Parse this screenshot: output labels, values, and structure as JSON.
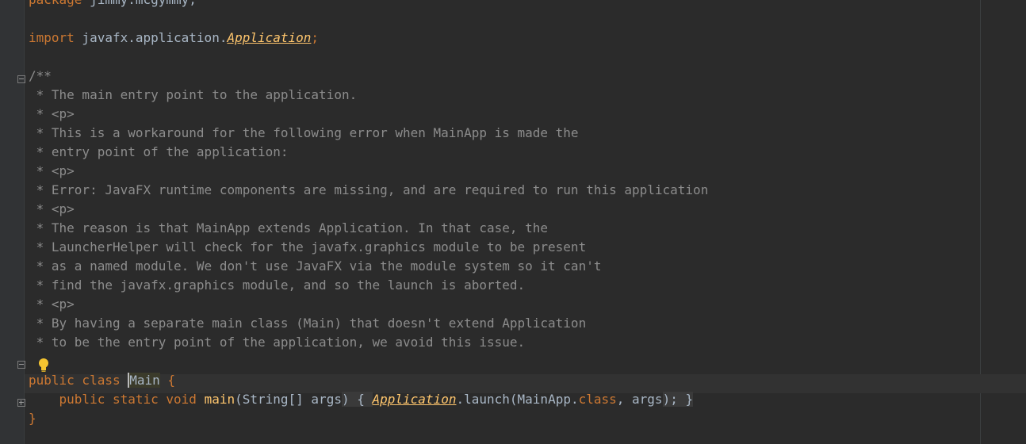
{
  "editor": {
    "lines": {
      "package_kw": "package",
      "package_name": " jimmy.mcgymmy;",
      "import_kw": "import",
      "import_path": " javafx.application.",
      "import_class": "Application",
      "import_end": ";",
      "doc_open": "/**",
      "doc_1": " * The main entry point to the application.",
      "doc_2": " * <p>",
      "doc_3": " * This is a workaround for the following error when MainApp is made the",
      "doc_4": " * entry point of the application:",
      "doc_5": " * <p>",
      "doc_6": " * Error: JavaFX runtime components are missing, and are required to run this application",
      "doc_7": " * <p>",
      "doc_8": " * The reason is that MainApp extends Application. In that case, the",
      "doc_9": " * LauncherHelper will check for the javafx.graphics module to be present",
      "doc_10": " * as a named module. We don't use JavaFX via the module system so it can't",
      "doc_11": " * find the javafx.graphics module, and so the launch is aborted.",
      "doc_12": " * <p>",
      "doc_13": " * By having a separate main class (Main) that doesn't extend Application",
      "doc_14": " * to be the entry point of the application, we avoid this issue.",
      "class_kw": "public class ",
      "class_name": "Main",
      "class_brace": " {",
      "main_kw": "    public static void ",
      "main_name": "main",
      "main_params_open": "(String[] ",
      "main_args": "args",
      "main_params_close": ")",
      "main_body_open": " { ",
      "main_call_class": "Application",
      "main_call_rest": ".launch(MainApp.",
      "main_call_classkw": "class",
      "main_call_comma": ", ",
      "main_call_args": "args",
      "main_call_end": ");",
      "main_body_close": " }",
      "close_brace": "}"
    },
    "icons": {
      "fold": "fold-icon",
      "bulb": "lightbulb-icon"
    },
    "colors": {
      "background": "#2b2b2b",
      "keyword": "#cc7832",
      "comment": "#8c8c8c",
      "function": "#ffc66d",
      "text": "#a9b7c6"
    }
  }
}
